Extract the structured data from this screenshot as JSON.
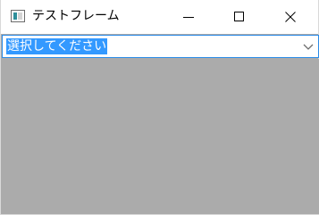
{
  "window": {
    "title": "テストフレーム",
    "icon": "app-window-icon",
    "controls": [
      "minimize-icon",
      "maximize-icon",
      "close-icon"
    ]
  },
  "combobox": {
    "selected_text": "選択してください",
    "arrow_icon": "chevron-down-icon"
  },
  "colors": {
    "titlebar_bg": "#ffffff",
    "client_bg": "#ababab",
    "selection_bg": "#3399ff",
    "focus_border": "#2b8ce8"
  }
}
